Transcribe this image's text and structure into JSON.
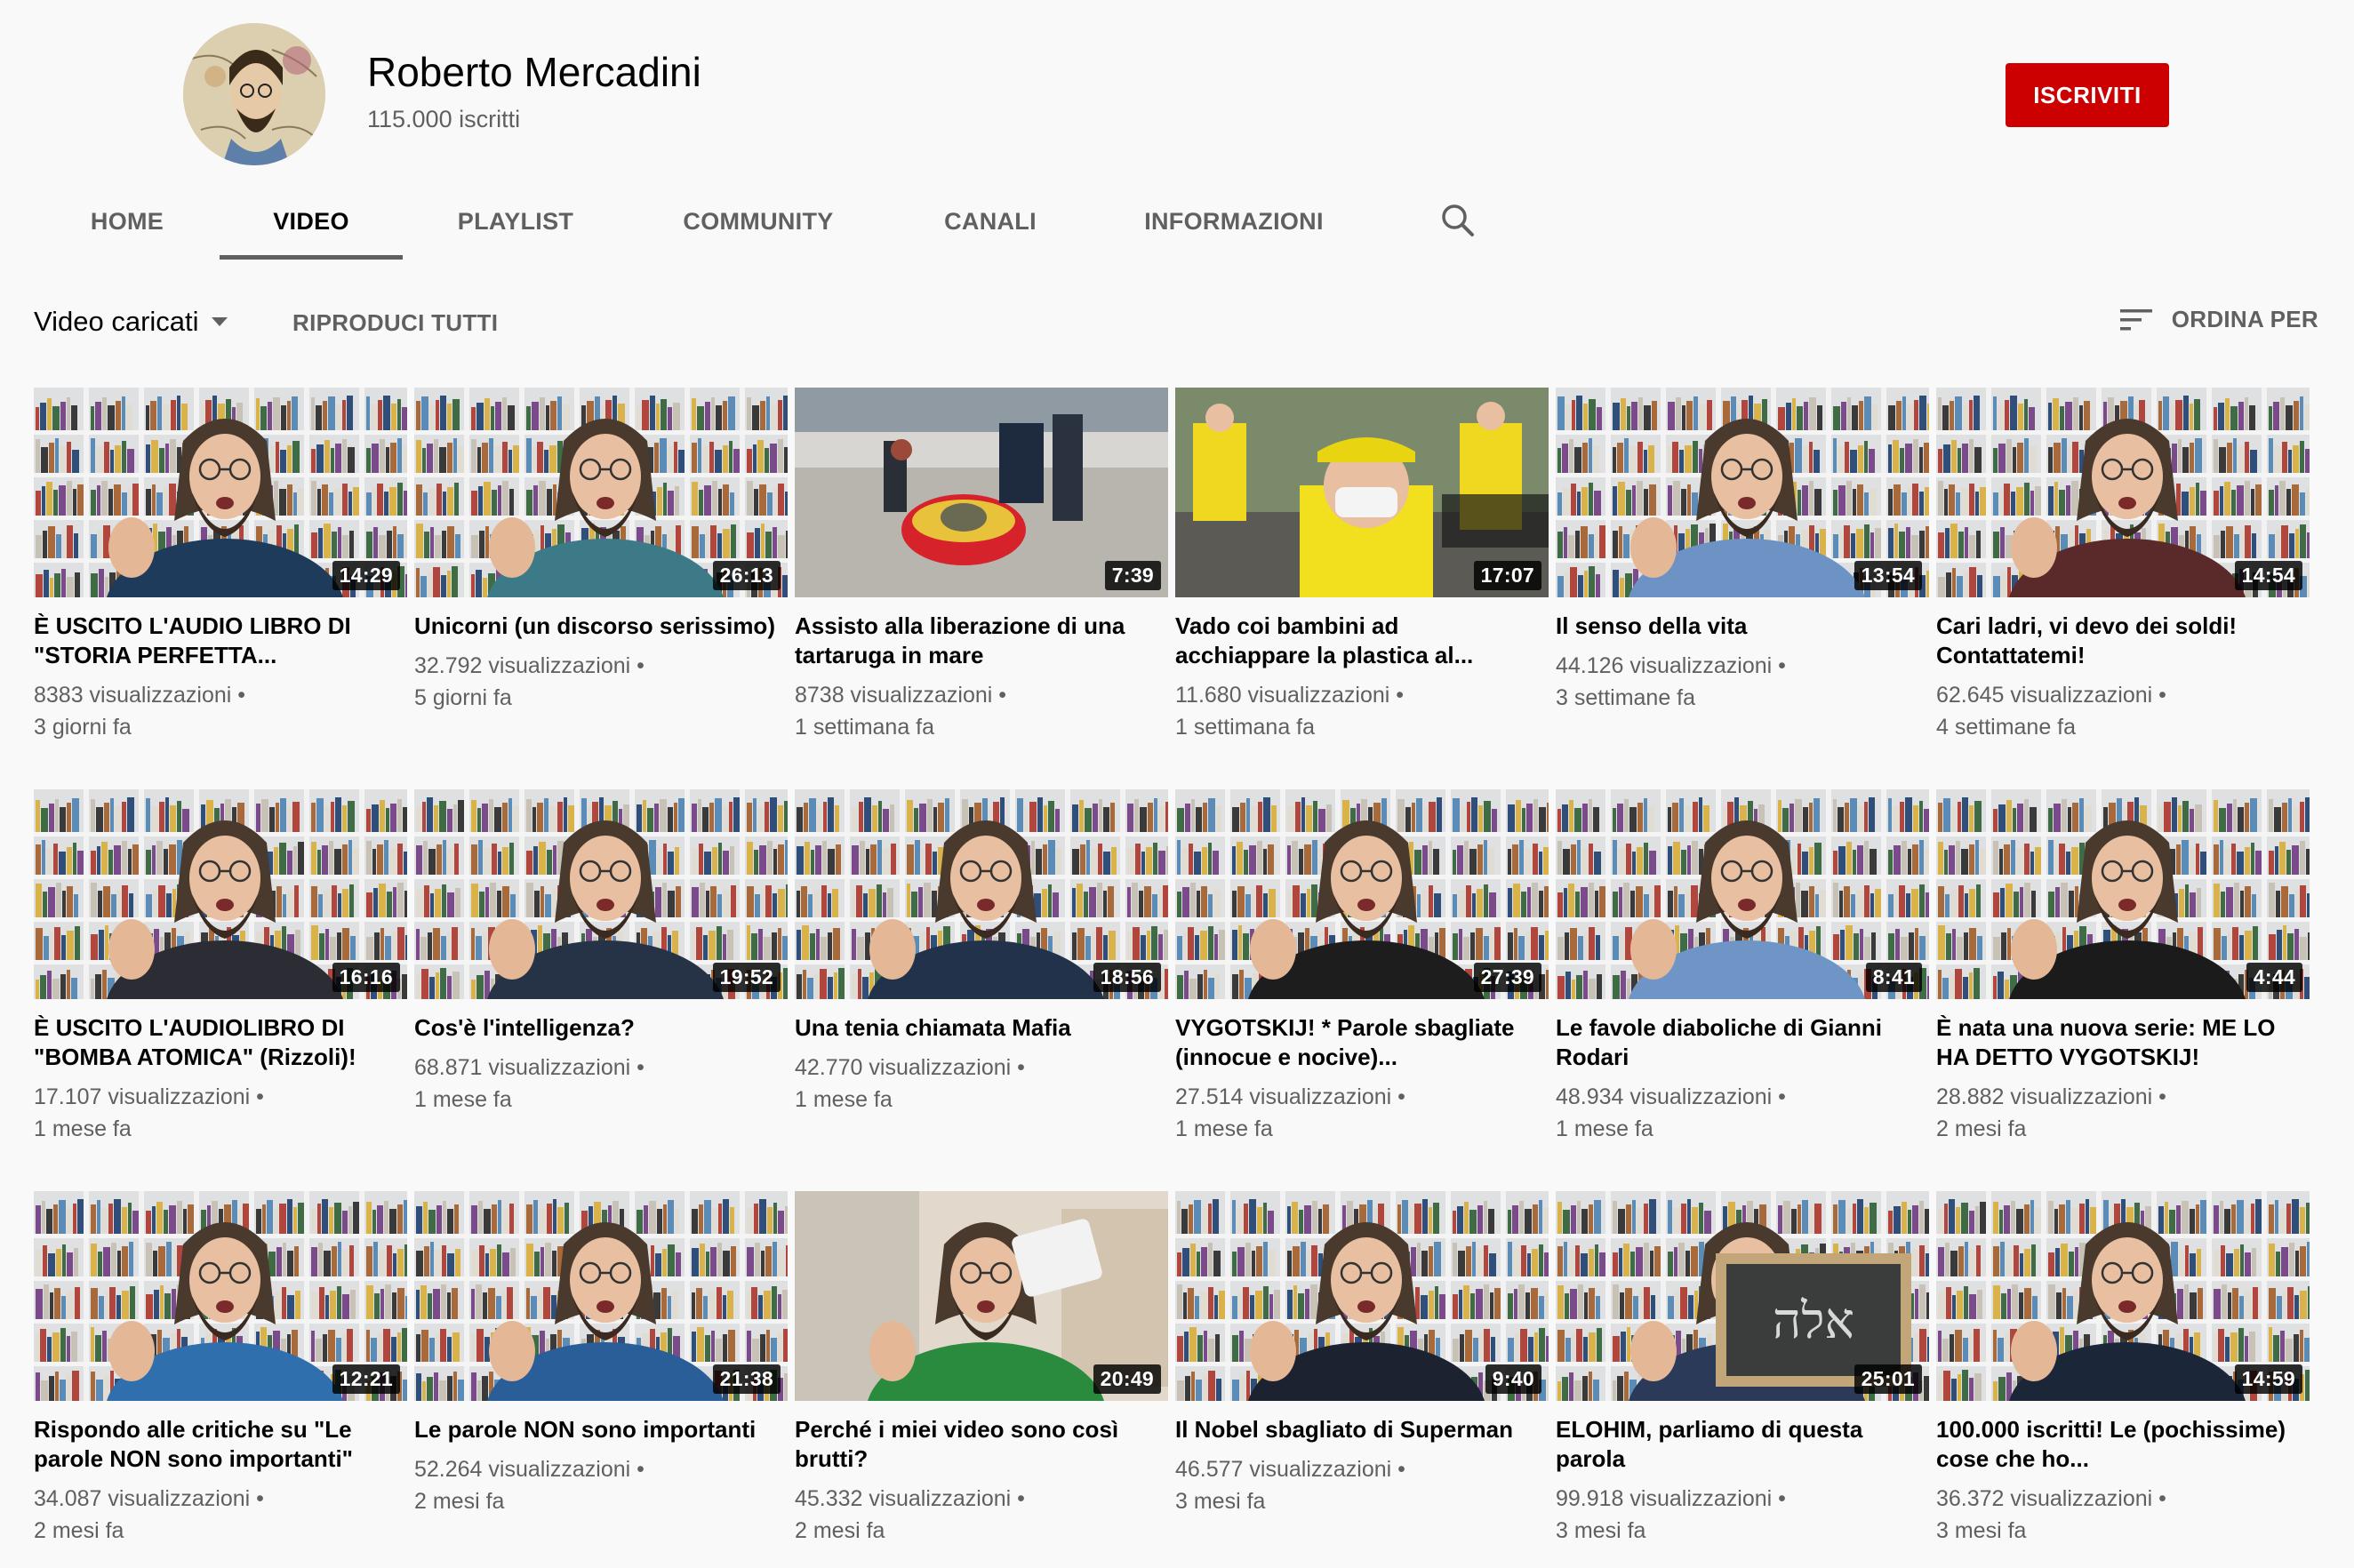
{
  "channel": {
    "name": "Roberto Mercadini",
    "subscribers": "115.000 iscritti",
    "subscribe_label": "ISCRIVITI"
  },
  "tabs": [
    {
      "label": "HOME",
      "active": false
    },
    {
      "label": "VIDEO",
      "active": true
    },
    {
      "label": "PLAYLIST",
      "active": false
    },
    {
      "label": "COMMUNITY",
      "active": false
    },
    {
      "label": "CANALI",
      "active": false
    },
    {
      "label": "INFORMAZIONI",
      "active": false
    }
  ],
  "toolbar": {
    "sort_label": "Video caricati",
    "play_all_label": "RIPRODUCI TUTTI",
    "order_label": "ORDINA PER"
  },
  "colors": {
    "subscribe": "#cc0000",
    "text_primary": "#030303",
    "text_secondary": "#606060",
    "background": "#f9f9f9"
  },
  "videos": [
    {
      "title": "È USCITO L'AUDIO LIBRO DI \"STORIA PERFETTA...",
      "views": "8383 visualizzazioni",
      "age": "3 giorni fa",
      "duration": "14:29",
      "scene": "person-studio",
      "shirt": "#1f3b5c"
    },
    {
      "title": "Unicorni (un discorso serissimo)",
      "views": "32.792 visualizzazioni",
      "age": "5 giorni fa",
      "duration": "26:13",
      "scene": "person-studio",
      "shirt": "#3c7a87"
    },
    {
      "title": "Assisto alla liberazione di una tartaruga in mare",
      "views": "8738 visualizzazioni",
      "age": "1 settimana fa",
      "duration": "7:39",
      "scene": "beach"
    },
    {
      "title": "Vado coi bambini ad acchiappare la plastica al...",
      "views": "11.680 visualizzazioni",
      "age": "1 settimana fa",
      "duration": "17:07",
      "scene": "kids"
    },
    {
      "title": "Il senso della vita",
      "views": "44.126 visualizzazioni",
      "age": "3 settimane fa",
      "duration": "13:54",
      "scene": "person-studio",
      "shirt": "#6d93c4"
    },
    {
      "title": "Cari ladri, vi devo dei soldi! Contattatemi!",
      "views": "62.645 visualizzazioni",
      "age": "4 settimane fa",
      "duration": "14:54",
      "scene": "person-studio",
      "shirt": "#5a2a2a"
    },
    {
      "title": "È USCITO L'AUDIOLIBRO DI \"BOMBA ATOMICA\" (Rizzoli)!",
      "views": "17.107 visualizzazioni",
      "age": "1 mese fa",
      "duration": "16:16",
      "scene": "person-studio",
      "shirt": "#2c2c34"
    },
    {
      "title": "Cos'è l'intelligenza?",
      "views": "68.871 visualizzazioni",
      "age": "1 mese fa",
      "duration": "19:52",
      "scene": "person-studio",
      "shirt": "#263245"
    },
    {
      "title": "Una tenia chiamata Mafia",
      "views": "42.770 visualizzazioni",
      "age": "1 mese fa",
      "duration": "18:56",
      "scene": "person-studio",
      "shirt": "#22324a"
    },
    {
      "title": "VYGOTSKIJ! * Parole sbagliate (innocue e nocive)...",
      "views": "27.514 visualizzazioni",
      "age": "1 mese fa",
      "duration": "27:39",
      "scene": "person-studio",
      "shirt": "#1d1d1d"
    },
    {
      "title": "Le favole diaboliche di Gianni Rodari",
      "views": "48.934 visualizzazioni",
      "age": "1 mese fa",
      "duration": "8:41",
      "scene": "person-studio",
      "shirt": "#6f95c6"
    },
    {
      "title": "È nata una nuova serie: ME LO HA DETTO VYGOTSKIJ!",
      "views": "28.882 visualizzazioni",
      "age": "2 mesi fa",
      "duration": "4:44",
      "scene": "person-studio",
      "shirt": "#1b1b1b"
    },
    {
      "title": "Rispondo alle critiche su \"Le parole NON sono importanti\"",
      "views": "34.087 visualizzazioni",
      "age": "2 mesi fa",
      "duration": "12:21",
      "scene": "person-studio",
      "shirt": "#2f6fae"
    },
    {
      "title": "Le parole NON sono importanti",
      "views": "52.264 visualizzazioni",
      "age": "2 mesi fa",
      "duration": "21:38",
      "scene": "person-studio",
      "shirt": "#2a5e98"
    },
    {
      "title": "Perché i miei video sono così brutti?",
      "views": "45.332 visualizzazioni",
      "age": "2 mesi fa",
      "duration": "20:49",
      "scene": "person-room",
      "shirt": "#2a8a3e"
    },
    {
      "title": "Il Nobel sbagliato di Superman",
      "views": "46.577 visualizzazioni",
      "age": "3 mesi fa",
      "duration": "9:40",
      "scene": "person-studio",
      "shirt": "#1c2230"
    },
    {
      "title": "ELOHIM, parliamo di questa parola",
      "views": "99.918 visualizzazioni",
      "age": "3 mesi fa",
      "duration": "25:01",
      "scene": "blackboard",
      "shirt": "#2c3a5a"
    },
    {
      "title": "100.000 iscritti! Le (pochissime) cose che ho...",
      "views": "36.372 visualizzazioni",
      "age": "3 mesi fa",
      "duration": "14:59",
      "scene": "person-studio",
      "shirt": "#1b2638"
    }
  ]
}
